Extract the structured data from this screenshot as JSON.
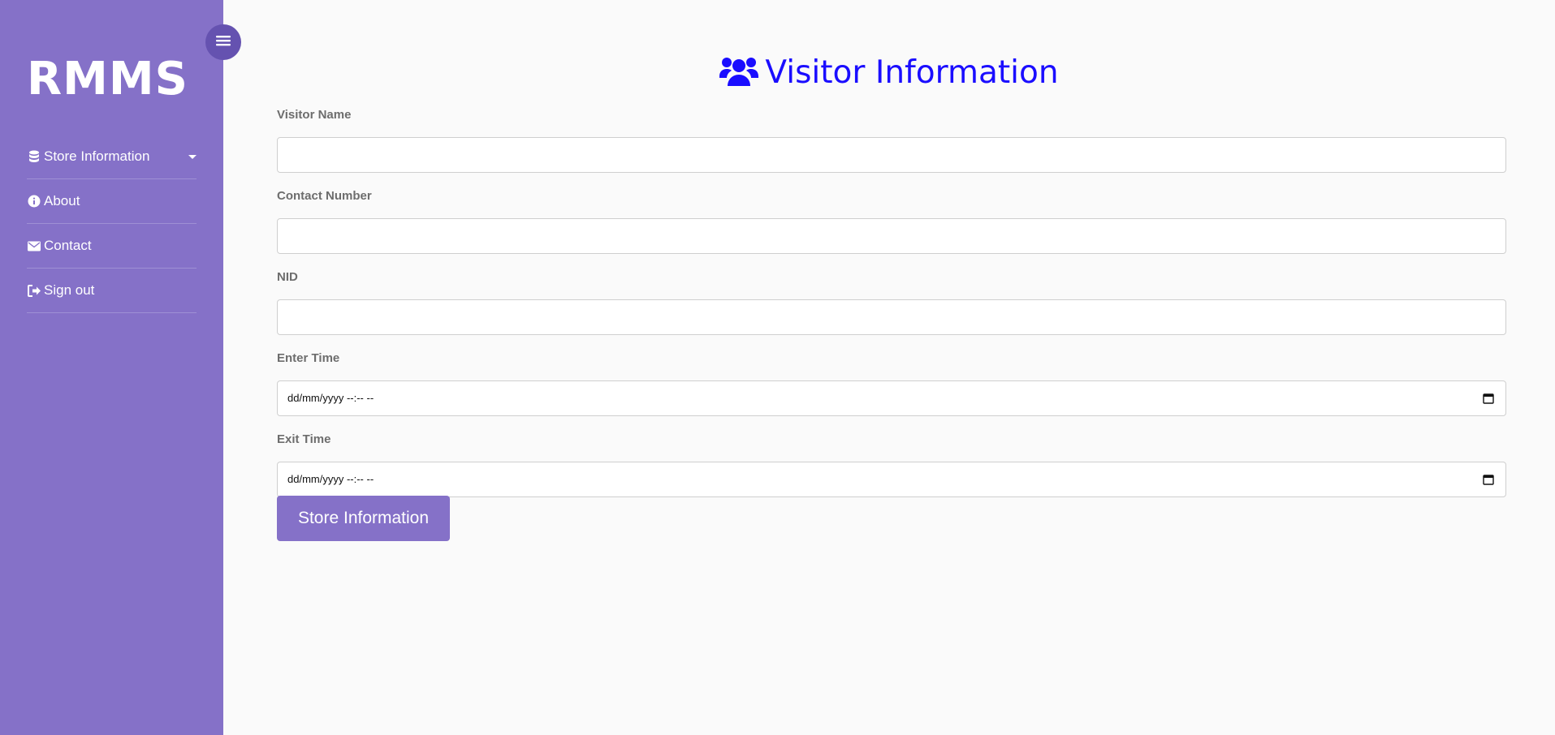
{
  "sidebar": {
    "brand": "RMMS",
    "items": [
      {
        "label": "Store Information",
        "icon": "database-icon"
      },
      {
        "label": "About",
        "icon": "info-circle-icon"
      },
      {
        "label": "Contact",
        "icon": "envelope-icon"
      },
      {
        "label": "Sign out",
        "icon": "sign-out-icon"
      }
    ]
  },
  "header": {
    "title": "Visitor Information",
    "icon": "users-icon"
  },
  "form": {
    "fields": [
      {
        "label": "Visitor Name",
        "value": ""
      },
      {
        "label": "Contact Number",
        "value": ""
      },
      {
        "label": "NID",
        "value": ""
      },
      {
        "label": "Enter Time",
        "value": "dd/mm/yyyy  --:-- --"
      },
      {
        "label": "Exit Time",
        "value": "dd/mm/yyyy  --:-- --"
      }
    ],
    "submit_label": "Store Information"
  },
  "colors": {
    "sidebar_bg": "#8571c8",
    "title": "#1a0dff",
    "toggle_bg": "#6552b0",
    "page_bg": "#fafafa"
  }
}
